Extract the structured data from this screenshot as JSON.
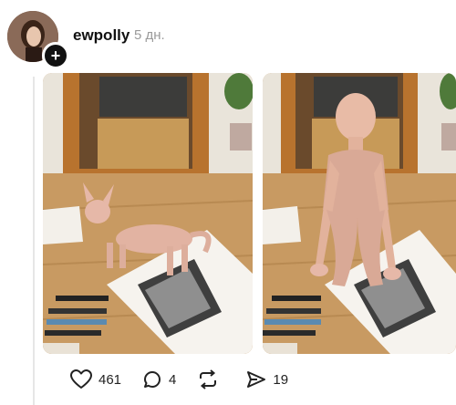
{
  "post": {
    "username": "ewpolly",
    "timestamp": "5 дн.",
    "follow_symbol": "+"
  },
  "actions": {
    "likes": "461",
    "replies": "4",
    "reposts": "",
    "shares": "19"
  },
  "icons": [
    "heart-icon",
    "comment-icon",
    "repost-icon",
    "share-icon",
    "plus-icon"
  ],
  "colors": {
    "text": "#111111",
    "muted": "#9a9a9a",
    "floor": "#c89a62"
  }
}
